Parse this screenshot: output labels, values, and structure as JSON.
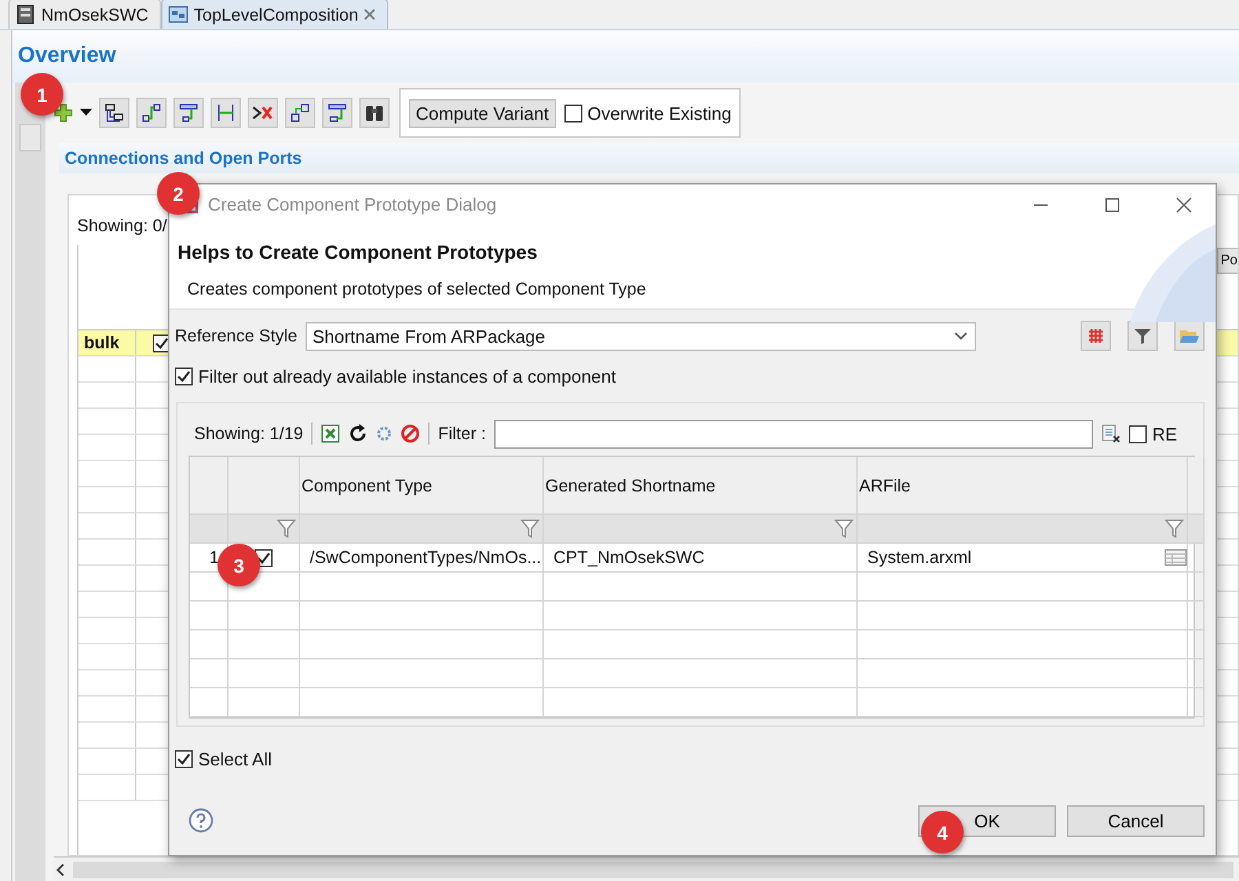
{
  "tabs": [
    {
      "label": "NmOsekSWC",
      "selected": false,
      "closable": false
    },
    {
      "label": "TopLevelComposition",
      "selected": true,
      "closable": true
    }
  ],
  "editor": {
    "title": "Overview",
    "toolbar": {
      "compute_button": "Compute Variant",
      "overwrite": {
        "label": "Overwrite Existing",
        "checked": false
      }
    },
    "section": {
      "title": "Connections and Open Ports",
      "showing": "Showing: 0/",
      "bulk_row": {
        "label": "bulk",
        "checked": true
      },
      "partial_button": "Po"
    }
  },
  "dialog": {
    "title": "Create Component Prototype Dialog",
    "heading": "Helps to Create Component Prototypes",
    "description": "Creates component prototypes of selected Component Type",
    "reference_style": {
      "label": "Reference Style",
      "value": "Shortname From ARPackage"
    },
    "filter_available": {
      "label": "Filter out already available instances of a component",
      "checked": true
    },
    "showing": "Showing: 1/19",
    "filter_label": "Filter :",
    "regex": {
      "label": "RE",
      "checked": false
    },
    "columns": [
      "Component Type",
      "Generated Shortname",
      "ARFile"
    ],
    "rows": [
      {
        "number": "1",
        "checked": true,
        "cells": [
          "/SwComponentTypes/NmOs...",
          "CPT_NmOsekSWC",
          "System.arxml"
        ]
      }
    ],
    "select_all": {
      "label": "Select All",
      "checked": true
    },
    "buttons": [
      "OK",
      "Cancel"
    ]
  },
  "callouts": [
    {
      "label": "1"
    },
    {
      "label": "2"
    },
    {
      "label": "3"
    },
    {
      "label": "4"
    }
  ]
}
